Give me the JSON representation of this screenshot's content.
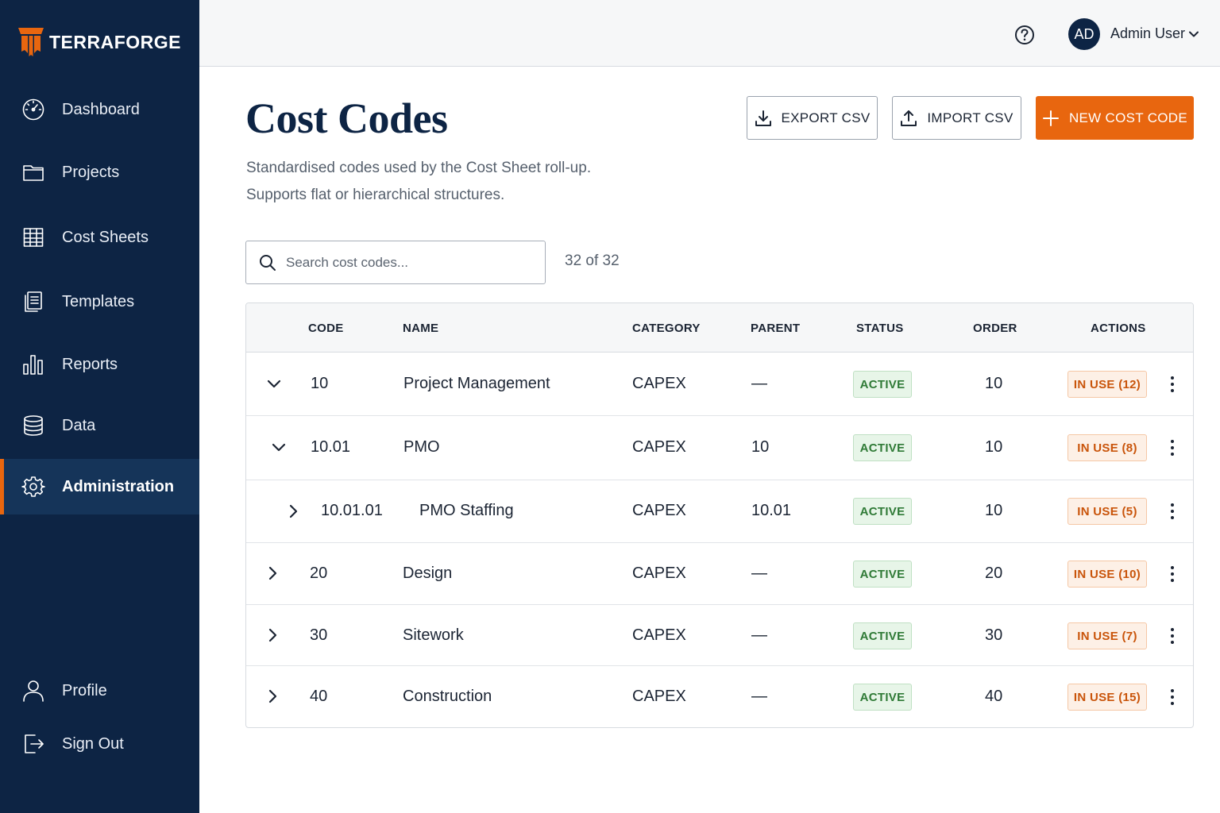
{
  "brand": {
    "name": "TERRAFORGE",
    "accent": "#e8660f",
    "sidebar_bg": "#0d2444"
  },
  "sidebar": {
    "items": [
      {
        "label": "Dashboard",
        "icon": "gauge-icon"
      },
      {
        "label": "Projects",
        "icon": "folder-icon"
      },
      {
        "label": "Cost Sheets",
        "icon": "grid-icon"
      },
      {
        "label": "Templates",
        "icon": "documents-icon"
      },
      {
        "label": "Reports",
        "icon": "bar-chart-icon"
      },
      {
        "label": "Data",
        "icon": "database-icon"
      },
      {
        "label": "Administration",
        "icon": "gear-icon",
        "active": true
      }
    ],
    "bottom": [
      {
        "label": "Profile",
        "icon": "user-icon"
      },
      {
        "label": "Sign Out",
        "icon": "sign-out-icon"
      }
    ]
  },
  "header": {
    "avatar_initials": "AD",
    "user_name": "Admin User"
  },
  "page": {
    "title": "Cost Codes",
    "subtitle_line1": "Standardised codes used by the Cost Sheet roll-up.",
    "subtitle_line2": "Supports flat or hierarchical structures."
  },
  "toolbar": {
    "export_label": "EXPORT CSV",
    "import_label": "IMPORT CSV",
    "new_label": "NEW COST CODE"
  },
  "search": {
    "placeholder": "Search cost codes...",
    "value": ""
  },
  "result_count": "32 of 32",
  "table": {
    "columns": {
      "code": "CODE",
      "name": "NAME",
      "category": "CATEGORY",
      "parent": "PARENT",
      "status": "STATUS",
      "order": "ORDER",
      "actions": "ACTIONS"
    },
    "rows": [
      {
        "code": "10",
        "name": "Project Management",
        "category": "CAPEX",
        "parent": "—",
        "status": "ACTIVE",
        "order": "10",
        "usage": "IN USE (12)",
        "expanded": true,
        "level": 0
      },
      {
        "code": "10.01",
        "name": "PMO",
        "category": "CAPEX",
        "parent": "10",
        "status": "ACTIVE",
        "order": "10",
        "usage": "IN USE (8)",
        "expanded": true,
        "level": 1
      },
      {
        "code": "10.01.01",
        "name": "PMO Staffing",
        "category": "CAPEX",
        "parent": "10.01",
        "status": "ACTIVE",
        "order": "10",
        "usage": "IN USE (5)",
        "expanded": false,
        "level": 2
      },
      {
        "code": "20",
        "name": "Design",
        "category": "CAPEX",
        "parent": "—",
        "status": "ACTIVE",
        "order": "20",
        "usage": "IN USE (10)",
        "expanded": false,
        "level": 0
      },
      {
        "code": "30",
        "name": "Sitework",
        "category": "CAPEX",
        "parent": "—",
        "status": "ACTIVE",
        "order": "30",
        "usage": "IN USE (7)",
        "expanded": false,
        "level": 0
      },
      {
        "code": "40",
        "name": "Construction",
        "category": "CAPEX",
        "parent": "—",
        "status": "ACTIVE",
        "order": "40",
        "usage": "IN USE (15)",
        "expanded": false,
        "level": 0
      }
    ]
  }
}
